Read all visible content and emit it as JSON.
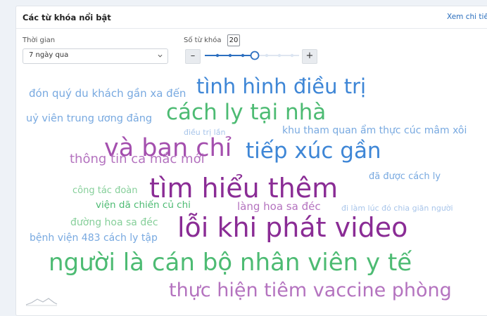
{
  "panel": {
    "title": "Các từ khóa nổi bật",
    "detail_link": "Xem chi tiết"
  },
  "filters": {
    "time_label": "Thời gian",
    "time_value": "7 ngày qua",
    "keyword_count_label": "Số từ khóa",
    "keyword_count_value": "20",
    "minus": "–",
    "plus": "+",
    "slider_level": 0.5
  },
  "colors": {
    "blue": "#3e86d6",
    "green": "#4dbb73",
    "purple": "#8a2c95",
    "light_purple": "#b473bf",
    "light_blue": "#78a9e0",
    "light_green": "#86cf9a"
  },
  "keywords": [
    "đón quý du khách gần xa đến",
    "tình hình điều trị",
    "uỷ viên trung ương đảng",
    "cách ly tại nhà",
    "điều trị lần",
    "khu tham quan ẩm thực cúc mâm xôi",
    "và ban chỉ",
    "tiếp xúc gần",
    "thông tin ca mắc mới",
    "đã được cách ly",
    "tìm hiểu thêm",
    "công tác đoàn",
    "viện dã chiến củ chi",
    "làng hoa sa đéc",
    "đi làm lúc đó chia giãn người",
    "đường hoa sa đéc",
    "lỗi khi phát video",
    "bệnh viện 483 cách ly tập",
    "người là cán bộ nhân viên y tế",
    "thực hiện tiêm vaccine phòng"
  ]
}
